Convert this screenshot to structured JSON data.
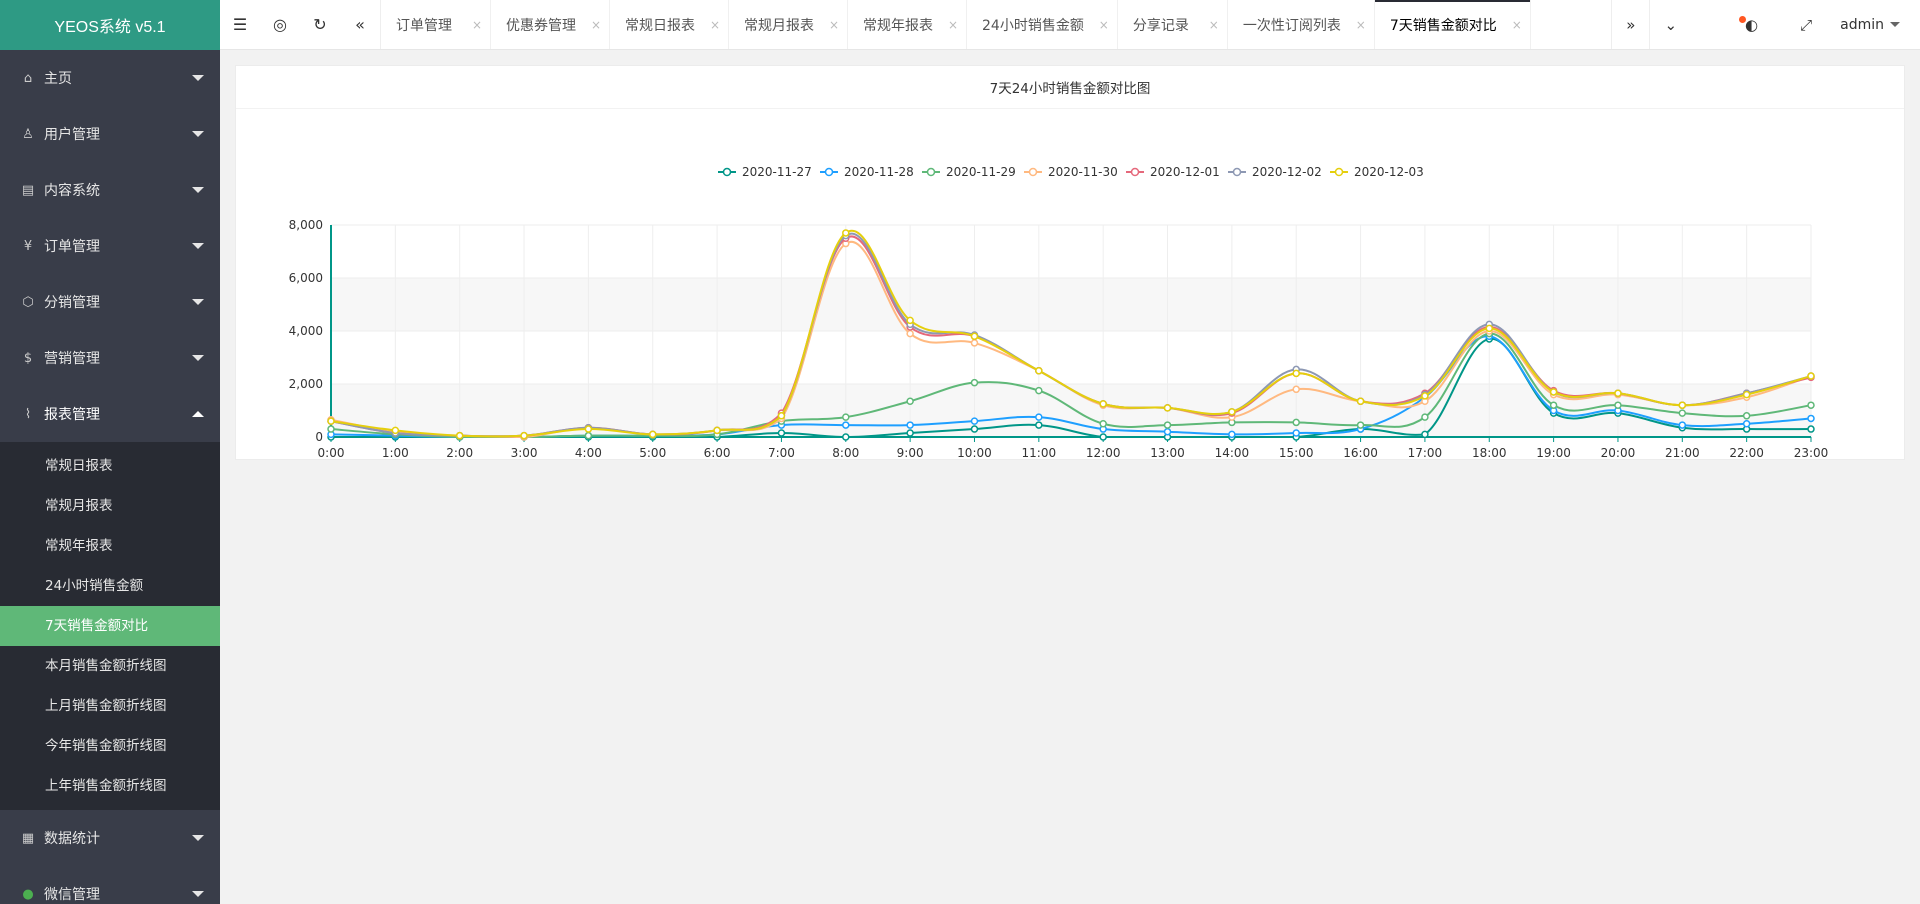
{
  "app": {
    "title": "YEOS系统 v5.1"
  },
  "sidebar": {
    "items": [
      {
        "label": "主页",
        "icon": "home-icon"
      },
      {
        "label": "用户管理",
        "icon": "user-icon"
      },
      {
        "label": "内容系统",
        "icon": "content-icon"
      },
      {
        "label": "订单管理",
        "icon": "yen-icon"
      },
      {
        "label": "分销管理",
        "icon": "cube-icon"
      },
      {
        "label": "营销管理",
        "icon": "dollar-icon"
      },
      {
        "label": "报表管理",
        "icon": "pulse-icon"
      }
    ],
    "report_sub": [
      "常规日报表",
      "常规月报表",
      "常规年报表",
      "24小时销售金额",
      "7天销售金额对比",
      "本月销售金额折线图",
      "上月销售金额折线图",
      "今年销售金额折线图",
      "上年销售金额折线图"
    ],
    "items_after": [
      {
        "label": "数据统计",
        "icon": "grid-icon"
      },
      {
        "label": "微信管理",
        "icon": "wechat-icon"
      }
    ]
  },
  "topbar": {
    "tabs": [
      "订单管理",
      "优惠券管理",
      "常规日报表",
      "常规月报表",
      "常规年报表",
      "24小时销售金额",
      "分享记录",
      "一次性订阅列表",
      "7天销售金额对比"
    ],
    "close_glyph": "×",
    "user": "admin"
  },
  "colors": {
    "sidebar_bg": "#393D49",
    "sidebar_sub_bg": "#282b33",
    "logo_bg": "#2e9a84",
    "active_green": "#5fb878"
  },
  "chart_data": {
    "type": "line",
    "title": "7天24小时销售金额对比图",
    "categories": [
      "0:00",
      "1:00",
      "2:00",
      "3:00",
      "4:00",
      "5:00",
      "6:00",
      "7:00",
      "8:00",
      "9:00",
      "10:00",
      "11:00",
      "12:00",
      "13:00",
      "14:00",
      "15:00",
      "16:00",
      "17:00",
      "18:00",
      "19:00",
      "20:00",
      "21:00",
      "22:00",
      "23:00"
    ],
    "ylim": [
      0,
      8000
    ],
    "yticks": [
      "0",
      "2,000",
      "4,000",
      "6,000",
      "8,000"
    ],
    "legend_position": "top-center",
    "series": [
      {
        "name": "2020-11-27",
        "color": "#009688",
        "values": [
          0,
          0,
          0,
          0,
          0,
          0,
          0,
          150,
          0,
          150,
          300,
          450,
          0,
          0,
          0,
          0,
          300,
          100,
          3700,
          900,
          900,
          350,
          300,
          300
        ]
      },
      {
        "name": "2020-11-28",
        "color": "#1e9fff",
        "values": [
          100,
          50,
          0,
          0,
          50,
          50,
          100,
          450,
          450,
          450,
          600,
          750,
          300,
          200,
          100,
          150,
          300,
          1500,
          3800,
          1000,
          1000,
          450,
          500,
          700
        ]
      },
      {
        "name": "2020-11-29",
        "color": "#5fb878",
        "values": [
          300,
          100,
          0,
          0,
          50,
          50,
          100,
          600,
          750,
          1350,
          2050,
          1750,
          500,
          450,
          550,
          550,
          450,
          750,
          3900,
          1200,
          1200,
          900,
          800,
          1200
        ]
      },
      {
        "name": "2020-11-30",
        "color": "#ffb980",
        "values": [
          650,
          200,
          50,
          0,
          350,
          100,
          250,
          700,
          7300,
          3900,
          3550,
          2500,
          1200,
          1100,
          750,
          1800,
          1350,
          1350,
          4000,
          1600,
          1600,
          1200,
          1500,
          2300
        ]
      },
      {
        "name": "2020-12-01",
        "color": "#e5687b",
        "values": [
          600,
          150,
          50,
          50,
          350,
          100,
          250,
          900,
          7500,
          4150,
          3800,
          2500,
          1250,
          1100,
          900,
          2400,
          1350,
          1650,
          4150,
          1750,
          1650,
          1200,
          1650,
          2250
        ]
      },
      {
        "name": "2020-12-02",
        "color": "#8d98b3",
        "values": [
          600,
          150,
          50,
          50,
          350,
          100,
          250,
          800,
          7600,
          4250,
          3850,
          2500,
          1250,
          1100,
          950,
          2550,
          1350,
          1600,
          4250,
          1700,
          1650,
          1200,
          1650,
          2300
        ]
      },
      {
        "name": "2020-12-03",
        "color": "#e5cf0d",
        "values": [
          600,
          250,
          50,
          50,
          300,
          100,
          250,
          800,
          7700,
          4400,
          3800,
          2500,
          1250,
          1100,
          950,
          2400,
          1350,
          1550,
          4100,
          1700,
          1650,
          1200,
          1600,
          2300
        ]
      }
    ]
  }
}
